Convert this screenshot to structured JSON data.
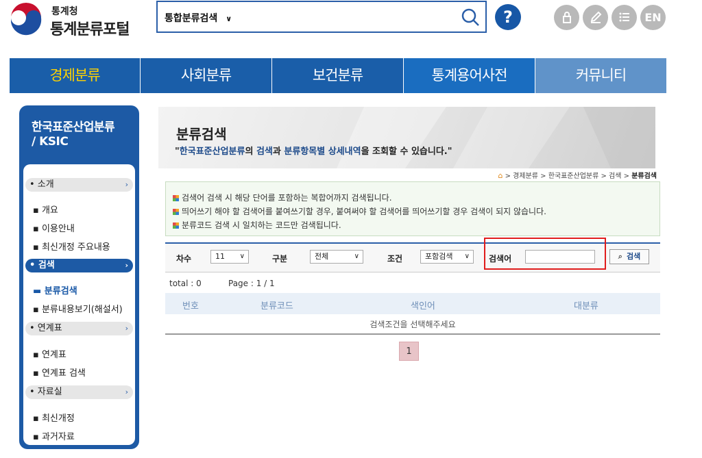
{
  "header": {
    "org_name": "통계청",
    "portal_name": "통계분류포털",
    "search_scope": "통합분류검색",
    "lang_label": "EN",
    "help_label": "?"
  },
  "icons": {
    "logo": "taegeuk-logo-icon",
    "search": "magnifier-icon",
    "lock": "lock-icon",
    "edit": "pencil-icon",
    "menu": "list-icon"
  },
  "colors": {
    "brand_blue": "#1a5ea9",
    "active_gnb_text": "#ffd200",
    "highlight_box": "#e01b1b"
  },
  "gnb": [
    {
      "label": "경제분류"
    },
    {
      "label": "사회분류"
    },
    {
      "label": "보건분류"
    },
    {
      "label": "통계용어사전"
    },
    {
      "label": "커뮤니티"
    }
  ],
  "sidebar": {
    "title_line1": "한국표준산업분류",
    "title_line2": "/ KSIC",
    "sections": [
      {
        "label": "• 소개",
        "items": [
          {
            "label": "▪ 개요"
          },
          {
            "label": "▪ 이용안내"
          },
          {
            "label": "▪ 최신개정 주요내용"
          }
        ]
      },
      {
        "label": "• 검색",
        "items": [
          {
            "label": "▬ 분류검색"
          },
          {
            "label": "▪ 분류내용보기(해설서)"
          }
        ]
      },
      {
        "label": "• 연계표",
        "items": [
          {
            "label": "▪ 연계표"
          },
          {
            "label": "▪ 연계표 검색"
          }
        ]
      },
      {
        "label": "• 자료실",
        "items": [
          {
            "label": "▪ 최신개정"
          },
          {
            "label": "▪ 과거자료"
          }
        ]
      }
    ]
  },
  "banner": {
    "title": "분류검색",
    "quote_open": "\"",
    "desc_hl1": "한국표준산업분류",
    "desc_t1": "의 ",
    "desc_hl2": "검색",
    "desc_t2": "과 ",
    "desc_hl3": "분류항목별 상세내역",
    "desc_t3": "을 조회할 수 있습니다.\""
  },
  "breadcrumb": {
    "path": " > 경제분류 > 한국표준산업분류 > 검색 > ",
    "current": "분류검색"
  },
  "notice": [
    "검색어 검색 시 해당 단어를 포함하는 복합어까지 검색됩니다.",
    "띄어쓰기 해야 할 검색어를 붙여쓰기할 경우, 붙여써야 할 검색어를 띄어쓰기할 경우 검색이 되지 않습니다.",
    "분류코드 검색 시 일치하는 코드만 검색됩니다."
  ],
  "filter": {
    "revision_label": "차수",
    "revision_value": "11",
    "division_label": "구분",
    "division_value": "전체",
    "condition_label": "조건",
    "condition_value": "포함검색",
    "keyword_label": "검색어",
    "keyword_value": "",
    "search_button": "검색"
  },
  "results": {
    "total": "total : 0",
    "page": "Page : 1 / 1",
    "columns": [
      "번호",
      "분류코드",
      "색인어",
      "대분류"
    ],
    "empty_message": "검색조건을 선택해주세요"
  },
  "pagination": {
    "current_page": "1"
  }
}
